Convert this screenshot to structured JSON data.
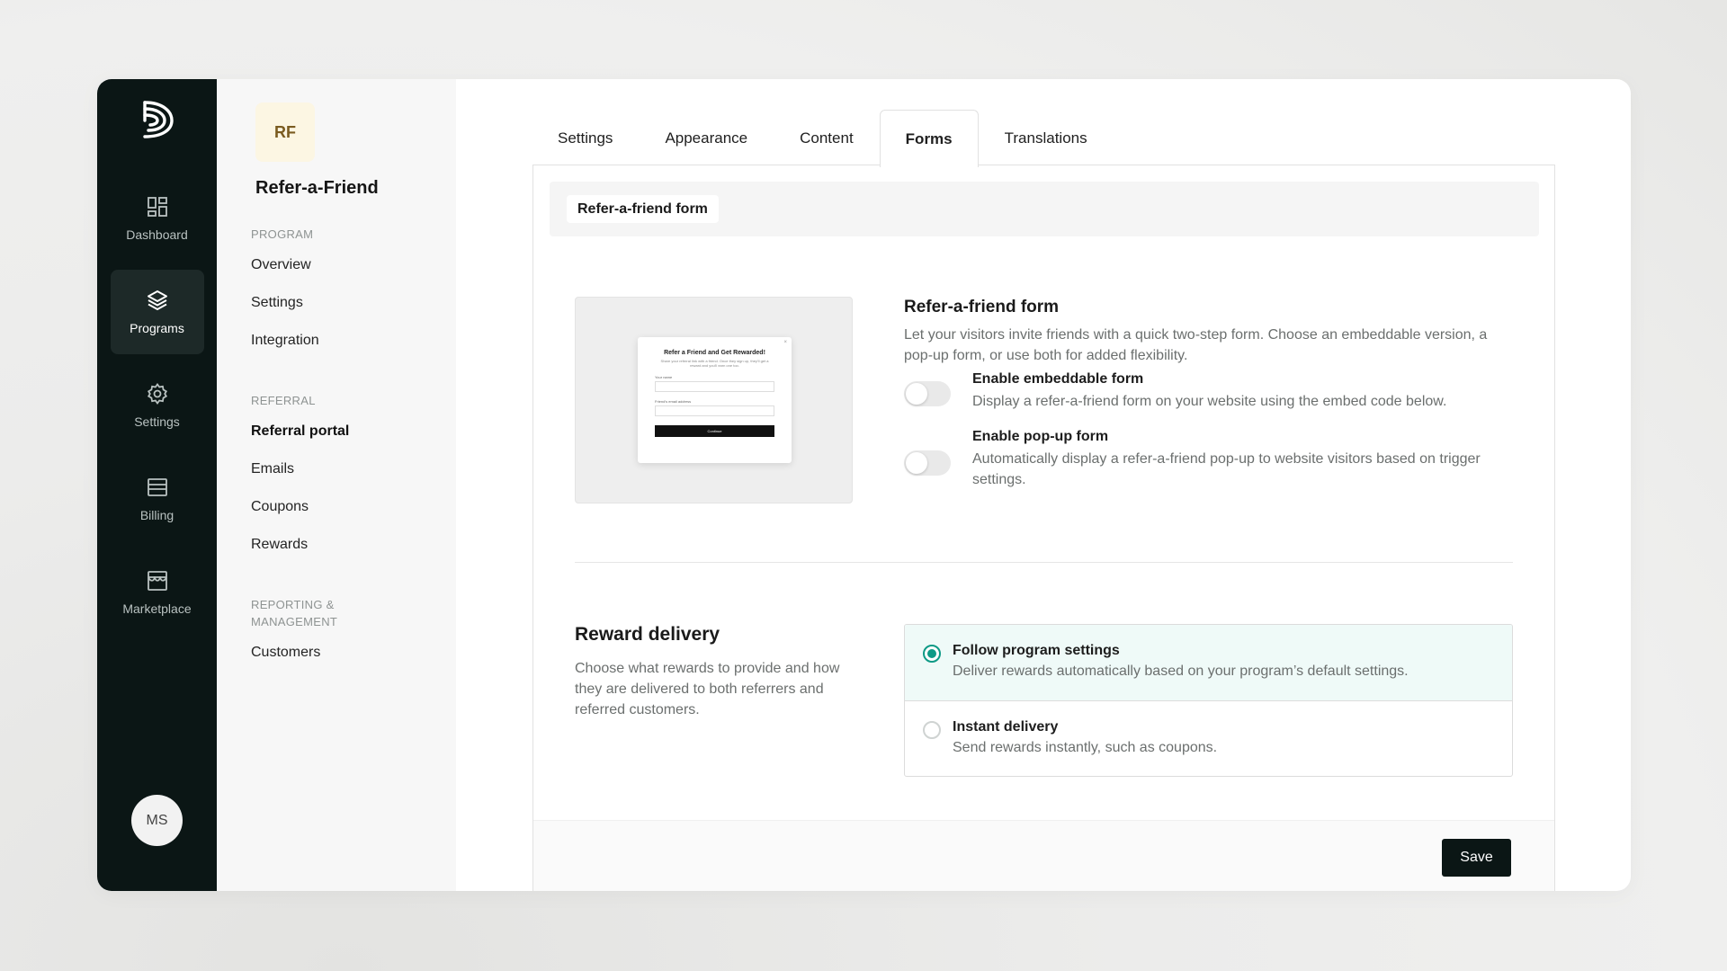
{
  "rail": {
    "logo_icon": "brand-logo-icon",
    "items": [
      {
        "label": "Dashboard",
        "icon": "dashboard-icon"
      },
      {
        "label": "Programs",
        "icon": "layers-icon",
        "active": true
      },
      {
        "label": "Settings",
        "icon": "gear-icon"
      },
      {
        "label": "Billing",
        "icon": "billing-icon"
      },
      {
        "label": "Marketplace",
        "icon": "store-icon"
      }
    ],
    "avatar_initials": "MS"
  },
  "program": {
    "badge": "RF",
    "name": "Refer-a-Friend"
  },
  "subnav": {
    "sections": [
      {
        "label": "PROGRAM",
        "links": [
          "Overview",
          "Settings",
          "Integration"
        ]
      },
      {
        "label": "REFERRAL",
        "links": [
          "Referral portal",
          "Emails",
          "Coupons",
          "Rewards"
        ]
      },
      {
        "label": "REPORTING & MANAGEMENT",
        "links": [
          "Customers"
        ]
      }
    ],
    "active_link": "Referral portal"
  },
  "tabs": [
    "Settings",
    "Appearance",
    "Content",
    "Forms",
    "Translations"
  ],
  "active_tab": "Forms",
  "panel": {
    "header_chip": "Refer-a-friend form",
    "preview": {
      "title": "Refer a Friend and Get Rewarded!",
      "subtitle": "Share your referral link with a friend. Once they sign up, they'll get a reward and you'll earn one too.",
      "field1": "Your name",
      "field2": "Friend's email address",
      "button": "Continue",
      "close": "×"
    },
    "form_section": {
      "title": "Refer-a-friend form",
      "description": "Let your visitors invite friends with a quick two-step form. Choose an embeddable version, a pop-up form, or use both for added flexibility.",
      "options": [
        {
          "title": "Enable embeddable form",
          "description": "Display a refer-a-friend form on your website using the embed code below.",
          "enabled": false
        },
        {
          "title": "Enable pop-up form",
          "description": "Automatically display a refer-a-friend pop-up to website visitors based on trigger settings.",
          "enabled": false
        }
      ]
    },
    "reward_delivery": {
      "title": "Reward delivery",
      "description": "Choose what rewards to provide and how they are delivered to both referrers and referred customers.",
      "options": [
        {
          "title": "Follow program settings",
          "description": "Deliver rewards automatically based on your program’s default settings.",
          "selected": true
        },
        {
          "title": "Instant delivery",
          "description": "Send rewards instantly, such as coupons.",
          "selected": false
        }
      ]
    },
    "save_label": "Save"
  },
  "colors": {
    "rail_bg": "#0b1615",
    "accent": "#0e9a86",
    "selected_bg": "#effaf8",
    "badge_bg": "#fcf6e3"
  }
}
